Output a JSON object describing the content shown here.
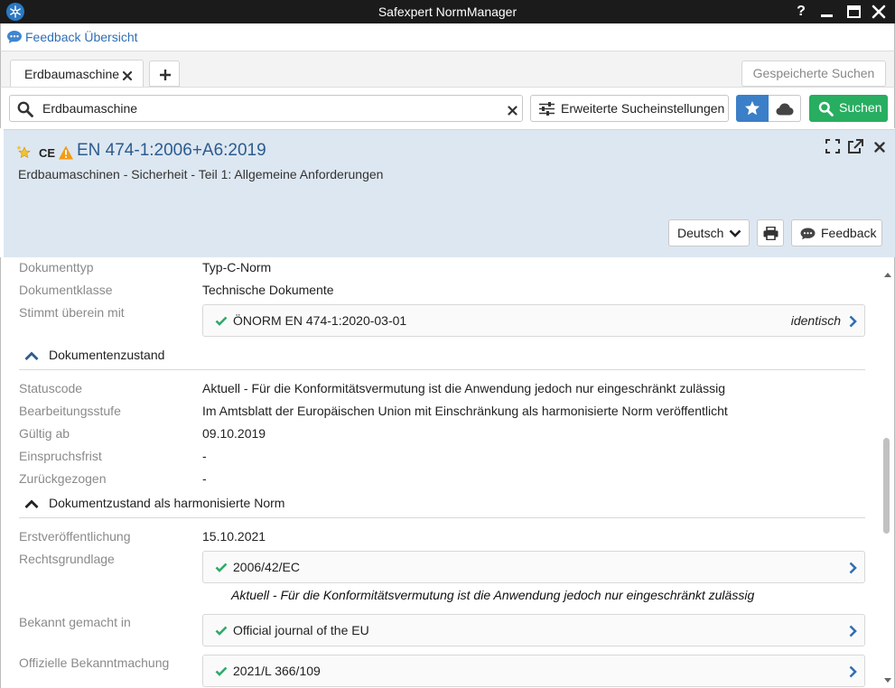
{
  "window": {
    "title": "Safexpert NormManager",
    "help_label": "?"
  },
  "feedback_link": "Feedback Übersicht",
  "tabs": [
    {
      "label": "Erdbaumaschine"
    }
  ],
  "saved_searches_label": "Gespeicherte Suchen",
  "search": {
    "value": "Erdbaumaschine",
    "advanced_label": "Erweiterte Sucheinstellungen",
    "search_label": "Suchen"
  },
  "document": {
    "mark_ce": "CE",
    "title": "EN 474-1:2006+A6:2019",
    "subtitle": "Erdbaumaschinen - Sicherheit - Teil 1: Allgemeine Anforderungen",
    "language": "Deutsch",
    "feedback_label": "Feedback"
  },
  "details": {
    "doc_type_label": "Dokumenttyp",
    "doc_type": "Typ-C-Norm",
    "doc_class_label": "Dokumentklasse",
    "doc_class": "Technische Dokumente",
    "matches_label": "Stimmt überein mit",
    "matches_value": "ÖNORM EN 474-1:2020-03-01",
    "matches_relation": "identisch"
  },
  "section_state": {
    "title": "Dokumentenzustand",
    "status_label": "Statuscode",
    "status": "Aktuell - Für die Konformitätsvermutung ist die Anwendung jedoch nur eingeschränkt zulässig",
    "stage_label": "Bearbeitungsstufe",
    "stage": "Im Amtsblatt der Europäischen Union mit Einschränkung als harmonisierte Norm veröffentlicht",
    "valid_label": "Gültig ab",
    "valid": "09.10.2019",
    "objection_label": "Einspruchsfrist",
    "objection": "-",
    "withdrawn_label": "Zurückgezogen",
    "withdrawn": "-"
  },
  "section_harmonized": {
    "title": "Dokumentzustand als harmonisierte Norm",
    "first_pub_label": "Erstveröffentlichung",
    "first_pub": "15.10.2021",
    "legal_label": "Rechtsgrundlage",
    "legal": "2006/42/EC",
    "legal_note": "Aktuell - Für die Konformitätsvermutung ist die Anwendung jedoch nur eingeschränkt zulässig",
    "published_label": "Bekannt gemacht in",
    "published": "Official journal of the EU",
    "official_label": "Offizielle Bekanntmachung",
    "official": "2021/L 366/109"
  },
  "colors": {
    "titlebar": "#1b1b1b",
    "accent_blue": "#3a7fc8",
    "search_green": "#27ae60",
    "header_panel": "#dde7f1",
    "check_green": "#2eab6a"
  }
}
